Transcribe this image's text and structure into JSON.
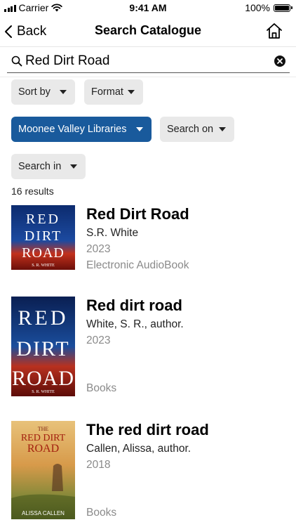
{
  "status_bar": {
    "carrier": "Carrier",
    "time": "9:41 AM",
    "battery": "100%",
    "battery_level": 1.0
  },
  "nav": {
    "back_label": "Back",
    "title": "Search Catalogue"
  },
  "search": {
    "value": "Red Dirt Road",
    "placeholder": ""
  },
  "filters": {
    "sort_by": "Sort by",
    "format": "Format",
    "library": "Moonee Valley Libraries",
    "search_on": "Search on",
    "search_in": "Search in"
  },
  "results_count": "16 results",
  "results": [
    {
      "title": "Red Dirt Road",
      "author": "S.R. White",
      "year": "2023",
      "format": "Electronic AudioBook",
      "cover": {
        "line1": "RED",
        "line2": "DIRT",
        "line3": "ROAD",
        "author": "S. R. WHITE"
      }
    },
    {
      "title": "Red dirt road",
      "author": "White, S. R., author.",
      "year": "2023",
      "format": "Books",
      "cover": {
        "line1": "RED",
        "line2": "DIRT",
        "line3": "ROAD",
        "author": "S. R. WHITE"
      }
    },
    {
      "title": "The red dirt road",
      "author": "Callen, Alissa, author.",
      "year": "2018",
      "format": "Books",
      "cover": {
        "line1": "THE",
        "line2": "RED DIRT",
        "line3": "ROAD",
        "author": "ALISSA CALLEN"
      }
    }
  ]
}
